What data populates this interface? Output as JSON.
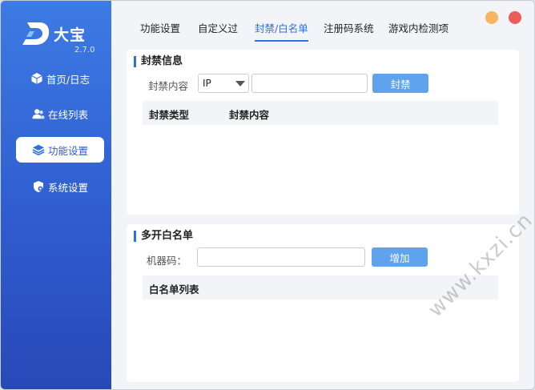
{
  "app": {
    "name": "大宝",
    "version": "2.7.0"
  },
  "sidebar": {
    "items": [
      {
        "label": "首页/日志",
        "icon": "cube-icon"
      },
      {
        "label": "在线列表",
        "icon": "users-icon"
      },
      {
        "label": "功能设置",
        "icon": "layers-icon",
        "active": true
      },
      {
        "label": "系统设置",
        "icon": "settings-shield-icon"
      }
    ]
  },
  "tabs": [
    {
      "label": "功能设置"
    },
    {
      "label": "自定义过"
    },
    {
      "label": "封禁/白名单",
      "active": true
    },
    {
      "label": "注册码系统"
    },
    {
      "label": "游戏内检测项"
    }
  ],
  "ban_panel": {
    "title": "封禁信息",
    "content_label": "封禁内容",
    "type_select_value": "IP",
    "content_input_value": "",
    "ban_button": "封禁",
    "columns": [
      "封禁类型",
      "封禁内容"
    ],
    "rows": []
  },
  "whitelist_panel": {
    "title": "多开白名单",
    "machine_code_label": "机器码：",
    "machine_code_value": "",
    "add_button": "增加",
    "list_header": "白名单列表",
    "rows": []
  },
  "watermark": "www.kxzi.cn",
  "colors": {
    "sidebar": "#2f5dcf",
    "accent": "#2f6fe0",
    "button": "#5fa2ee",
    "minimize": "#f6b65f",
    "close": "#ee5b5b"
  }
}
